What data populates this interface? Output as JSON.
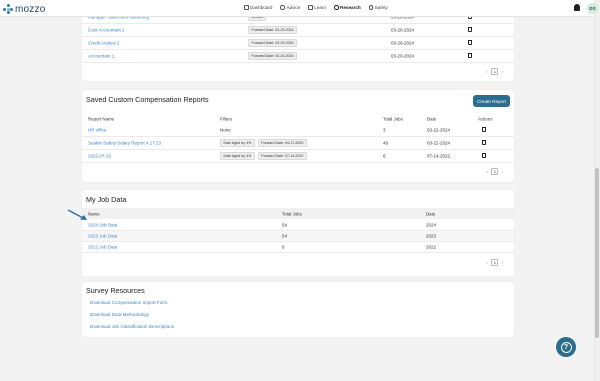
{
  "app": {
    "logo_text": "mozzo",
    "avatar_initials": "DS"
  },
  "nav": [
    {
      "label": "Dashboard",
      "icon": "calendar-icon"
    },
    {
      "label": "Advice",
      "icon": "advice-icon"
    },
    {
      "label": "Learn",
      "icon": "book-icon"
    },
    {
      "label": "Research",
      "icon": "research-icon",
      "active": true
    },
    {
      "label": "Safety",
      "icon": "safety-icon"
    }
  ],
  "jobs_section": {
    "rows": [
      {
        "name": "Manager, Sales and Marketing",
        "filter": "Default",
        "date": "03-20-2024"
      },
      {
        "name": "Cost Accountant 2",
        "filter": "Forward Date: 03-20-2024",
        "date": "03-20-2024"
      },
      {
        "name": "Credit Analyst 2",
        "filter": "Forward Date: 03-20-2024",
        "date": "03-20-2024"
      },
      {
        "name": "Accountant 1",
        "filter": "Forward Date: 03-20-2024",
        "date": "03-20-2024"
      }
    ],
    "page": "1"
  },
  "custom_reports": {
    "title": "Saved Custom Compensation Reports",
    "create_button": "Create Report",
    "headers": {
      "name": "Report Name",
      "filters": "Filters",
      "jobs": "Total Jobs",
      "date": "Date",
      "actions": "Actions"
    },
    "rows": [
      {
        "name": "HR office",
        "filters": [
          "None"
        ],
        "plain_filter": true,
        "jobs": "3",
        "date": "03-22-2024"
      },
      {
        "name": "Seattle Safety Salary Report 4.17.23",
        "filters": [
          "Date Aged by 4%",
          "Forward Date: 04-17-2023"
        ],
        "jobs": "49",
        "date": "03-22-2024"
      },
      {
        "name": "2022-07-15",
        "filters": [
          "Date Aged by 4%",
          "Forward Date: 07-14-2022"
        ],
        "jobs": "6",
        "date": "07-14-2022"
      }
    ],
    "page": "1"
  },
  "my_job_data": {
    "title": "My Job Data",
    "headers": {
      "name": "Name",
      "jobs": "Total Jobs",
      "date": "Date"
    },
    "rows": [
      {
        "name": "2024 Job Data",
        "jobs": "54",
        "date": "2024"
      },
      {
        "name": "2023 Job Data",
        "jobs": "54",
        "date": "2023"
      },
      {
        "name": "2022 Job Data",
        "jobs": "6",
        "date": "2022"
      }
    ],
    "page": "1"
  },
  "survey_resources": {
    "title": "Survey Resources",
    "links": [
      "Download Compensation Import Form",
      "Download Data Methodology",
      "Download Job Classification Descriptions"
    ]
  },
  "colors": {
    "accent": "#2a6d8f",
    "link": "#3a87c8",
    "arrow": "#2d6ea3"
  }
}
